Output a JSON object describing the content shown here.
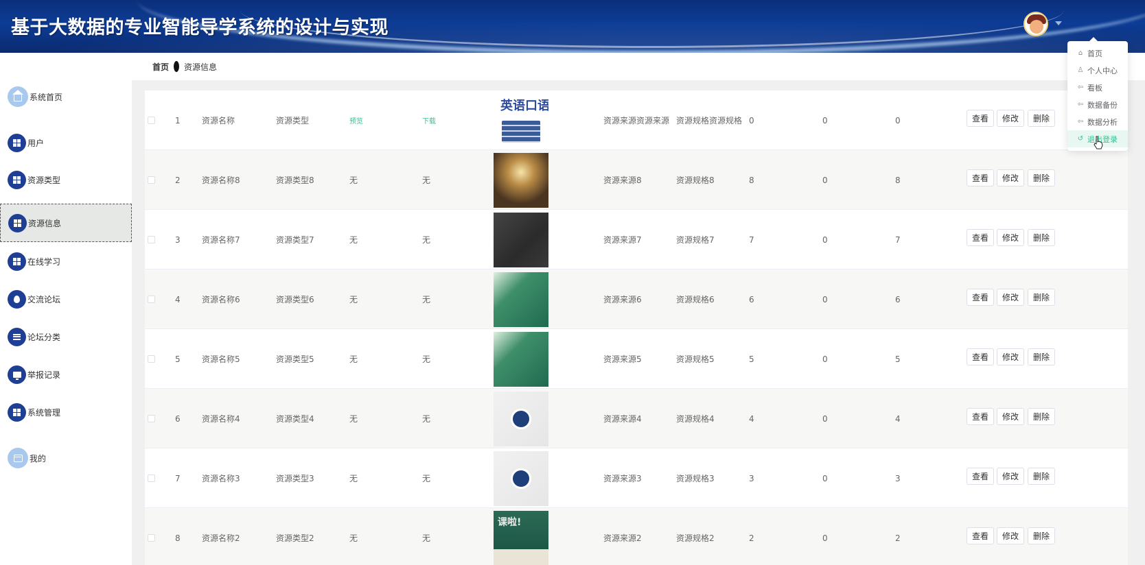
{
  "header": {
    "title": "基于大数据的专业智能导学系统的设计与实现",
    "avatar_icon": "avatar-image",
    "caret_icon": "caret-down-icon"
  },
  "sidebar": {
    "items": [
      {
        "label": "系统首页",
        "icon": "home-icon"
      },
      {
        "label": "用户",
        "icon": "grid-icon"
      },
      {
        "label": "资源类型",
        "icon": "grid-icon"
      },
      {
        "label": "资源信息",
        "icon": "grid-icon",
        "active": true
      },
      {
        "label": "在线学习",
        "icon": "grid-icon"
      },
      {
        "label": "交流论坛",
        "icon": "pin-icon"
      },
      {
        "label": "论坛分类",
        "icon": "list-icon"
      },
      {
        "label": "举报记录",
        "icon": "monitor-icon"
      },
      {
        "label": "系统管理",
        "icon": "grid-icon"
      },
      {
        "label": "我的",
        "icon": "card-icon"
      }
    ]
  },
  "breadcrumb": {
    "home": "首页",
    "current": "资源信息"
  },
  "table": {
    "rows": [
      {
        "index": "1",
        "name": "资源名称",
        "type": "资源类型",
        "preview": "预览",
        "download": "下载",
        "thumb_text": "英语口语",
        "source": "资源来源资源来源",
        "spec": "资源规格资源规格",
        "c1": "0",
        "c2": "0",
        "c3": "0"
      },
      {
        "index": "2",
        "name": "资源名称8",
        "type": "资源类型8",
        "preview": "无",
        "download": "无",
        "thumb_text": "",
        "source": "资源来源8",
        "spec": "资源规格8",
        "c1": "8",
        "c2": "0",
        "c3": "8"
      },
      {
        "index": "3",
        "name": "资源名称7",
        "type": "资源类型7",
        "preview": "无",
        "download": "无",
        "thumb_text": "",
        "source": "资源来源7",
        "spec": "资源规格7",
        "c1": "7",
        "c2": "0",
        "c3": "7"
      },
      {
        "index": "4",
        "name": "资源名称6",
        "type": "资源类型6",
        "preview": "无",
        "download": "无",
        "thumb_text": "",
        "source": "资源来源6",
        "spec": "资源规格6",
        "c1": "6",
        "c2": "0",
        "c3": "6"
      },
      {
        "index": "5",
        "name": "资源名称5",
        "type": "资源类型5",
        "preview": "无",
        "download": "无",
        "thumb_text": "",
        "source": "资源来源5",
        "spec": "资源规格5",
        "c1": "5",
        "c2": "0",
        "c3": "5"
      },
      {
        "index": "6",
        "name": "资源名称4",
        "type": "资源类型4",
        "preview": "无",
        "download": "无",
        "thumb_text": "",
        "source": "资源来源4",
        "spec": "资源规格4",
        "c1": "4",
        "c2": "0",
        "c3": "4"
      },
      {
        "index": "7",
        "name": "资源名称3",
        "type": "资源类型3",
        "preview": "无",
        "download": "无",
        "thumb_text": "",
        "source": "资源来源3",
        "spec": "资源规格3",
        "c1": "3",
        "c2": "0",
        "c3": "3"
      },
      {
        "index": "8",
        "name": "资源名称2",
        "type": "资源类型2",
        "preview": "无",
        "download": "无",
        "thumb_text": "课啦!",
        "source": "资源来源2",
        "spec": "资源规格2",
        "c1": "2",
        "c2": "0",
        "c3": "2"
      }
    ],
    "actions": {
      "view": "查看",
      "edit": "修改",
      "delete": "删除"
    }
  },
  "dropdown": {
    "items": [
      {
        "label": "首页",
        "icon": "home-outline-icon"
      },
      {
        "label": "个人中心",
        "icon": "user-outline-icon"
      },
      {
        "label": "看板",
        "icon": "back-arrow-icon"
      },
      {
        "label": "数据备份",
        "icon": "back-arrow-icon"
      },
      {
        "label": "数据分析",
        "icon": "back-arrow-icon"
      },
      {
        "label": "退出登录",
        "icon": "logout-icon",
        "hover": true
      }
    ]
  },
  "colors": {
    "header_bg": "#0d3c96",
    "sidebar_icon_bg": "#1f3f94",
    "link": "#3cbf8f",
    "active_bg": "#e6e8e6"
  }
}
